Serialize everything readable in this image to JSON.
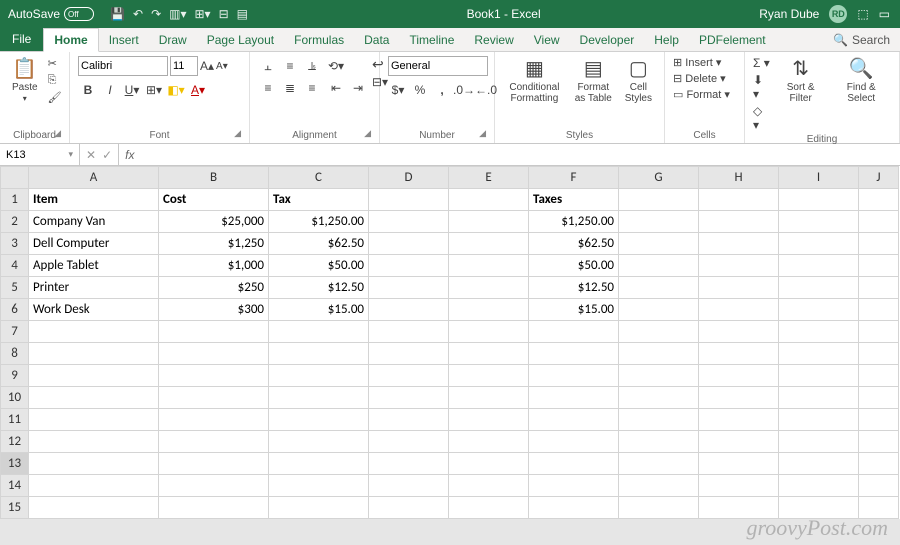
{
  "title": "Book1 - Excel",
  "user": {
    "name": "Ryan Dube",
    "initials": "RD"
  },
  "autosave": {
    "label": "AutoSave",
    "state": "Off"
  },
  "tabs": [
    "File",
    "Home",
    "Insert",
    "Draw",
    "Page Layout",
    "Formulas",
    "Data",
    "Timeline",
    "Review",
    "View",
    "Developer",
    "Help",
    "PDFelement"
  ],
  "activeTab": "Home",
  "search": "Search",
  "ribbon": {
    "clipboard": {
      "label": "Clipboard",
      "paste": "Paste"
    },
    "font": {
      "label": "Font",
      "name": "Calibri",
      "size": "11"
    },
    "alignment": {
      "label": "Alignment"
    },
    "number": {
      "label": "Number",
      "format": "General"
    },
    "styles": {
      "label": "Styles",
      "cond": "Conditional Formatting",
      "table": "Format as Table",
      "cell": "Cell Styles"
    },
    "cells": {
      "label": "Cells",
      "insert": "Insert",
      "delete": "Delete",
      "format": "Format"
    },
    "editing": {
      "label": "Editing",
      "sort": "Sort & Filter",
      "find": "Find & Select"
    }
  },
  "namebox": "K13",
  "formula": "",
  "columns": [
    "A",
    "B",
    "C",
    "D",
    "E",
    "F",
    "G",
    "H",
    "I",
    "J"
  ],
  "rowCount": 15,
  "colWidths": {
    "A": 130,
    "B": 110,
    "C": 100,
    "D": 80,
    "E": 80,
    "F": 90,
    "G": 80,
    "H": 80,
    "I": 80,
    "J": 40
  },
  "selected": {
    "row": 13,
    "col": "K"
  },
  "data": {
    "1": {
      "A": {
        "v": "Item",
        "b": true
      },
      "B": {
        "v": "Cost",
        "b": true
      },
      "C": {
        "v": "Tax",
        "b": true
      },
      "F": {
        "v": "Taxes",
        "b": true
      }
    },
    "2": {
      "A": {
        "v": "Company Van"
      },
      "B": {
        "v": "$25,000",
        "n": true
      },
      "C": {
        "v": "$1,250.00",
        "n": true
      },
      "F": {
        "v": "$1,250.00",
        "n": true
      }
    },
    "3": {
      "A": {
        "v": "Dell Computer"
      },
      "B": {
        "v": "$1,250",
        "n": true
      },
      "C": {
        "v": "$62.50",
        "n": true
      },
      "F": {
        "v": "$62.50",
        "n": true
      }
    },
    "4": {
      "A": {
        "v": "Apple Tablet"
      },
      "B": {
        "v": "$1,000",
        "n": true
      },
      "C": {
        "v": "$50.00",
        "n": true
      },
      "F": {
        "v": "$50.00",
        "n": true
      }
    },
    "5": {
      "A": {
        "v": "Printer"
      },
      "B": {
        "v": "$250",
        "n": true
      },
      "C": {
        "v": "$12.50",
        "n": true
      },
      "F": {
        "v": "$12.50",
        "n": true
      }
    },
    "6": {
      "A": {
        "v": "Work Desk"
      },
      "B": {
        "v": "$300",
        "n": true
      },
      "C": {
        "v": "$15.00",
        "n": true
      },
      "F": {
        "v": "$15.00",
        "n": true
      }
    }
  },
  "watermark": "groovyPost.com"
}
